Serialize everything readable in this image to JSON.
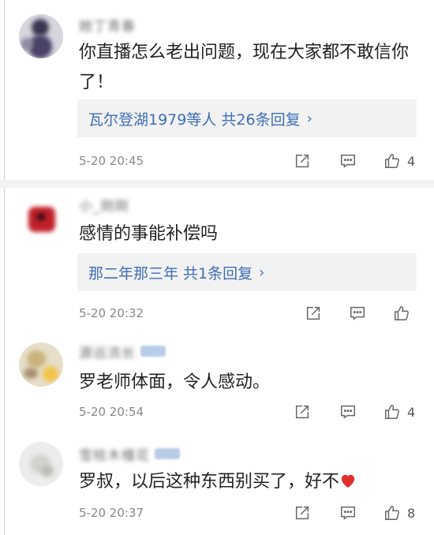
{
  "comments": [
    {
      "username": "她丁青春",
      "text": "你直播怎么老出问题，现在大家都不敢信你了！",
      "reply_summary": "瓦尔登湖1979等人  共26条回复",
      "time": "5-20 20:45",
      "likes": "4"
    },
    {
      "username": "小_刚刚",
      "text": "感情的事能补偿吗",
      "reply_summary": "那二年那三年  共1条回复",
      "time": "5-20 20:32",
      "likes": ""
    },
    {
      "username": "源远流长",
      "text": "罗老师体面，令人感动。",
      "time": "5-20 20:54",
      "likes": "4"
    },
    {
      "username": "雪枝木槿花",
      "text": "罗叔，以后这种东西别买了，好不",
      "time": "5-20 20:37",
      "likes": "8"
    }
  ],
  "icons": {
    "share": "share-icon",
    "reply": "comment-icon",
    "like": "thumbs-up-icon",
    "emoji": "heart-icon"
  },
  "colors": {
    "link_blue": "#3e6fb5",
    "heart_red": "#e0302c"
  }
}
